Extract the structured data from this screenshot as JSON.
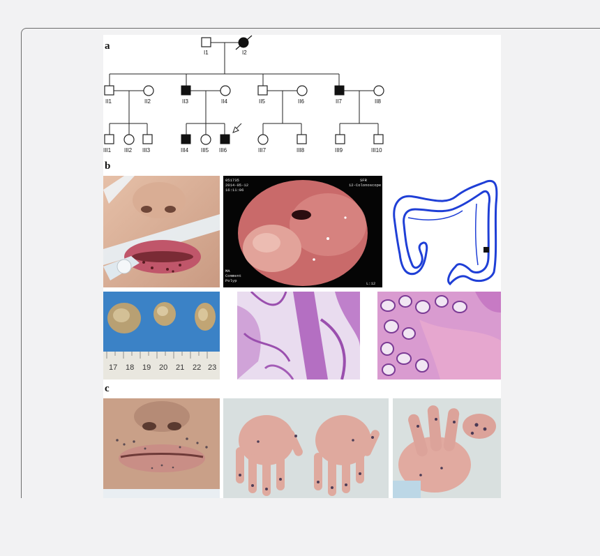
{
  "figure": {
    "panel_labels": [
      "a",
      "b",
      "c"
    ]
  },
  "pedigree": {
    "members": [
      {
        "id": "I1",
        "sex": "male",
        "affected": false,
        "deceased": false
      },
      {
        "id": "I2",
        "sex": "female",
        "affected": true,
        "deceased": true
      },
      {
        "id": "II1",
        "sex": "male",
        "affected": false
      },
      {
        "id": "II2",
        "sex": "female",
        "affected": false
      },
      {
        "id": "II3",
        "sex": "male",
        "affected": true
      },
      {
        "id": "II4",
        "sex": "female",
        "affected": false
      },
      {
        "id": "II5",
        "sex": "male",
        "affected": false
      },
      {
        "id": "II6",
        "sex": "female",
        "affected": false
      },
      {
        "id": "II7",
        "sex": "male",
        "affected": true
      },
      {
        "id": "II8",
        "sex": "female",
        "affected": false
      },
      {
        "id": "III1",
        "sex": "male",
        "affected": false
      },
      {
        "id": "III2",
        "sex": "female",
        "affected": false
      },
      {
        "id": "III3",
        "sex": "male",
        "affected": false
      },
      {
        "id": "III4",
        "sex": "male",
        "affected": true
      },
      {
        "id": "III5",
        "sex": "female",
        "affected": false
      },
      {
        "id": "III6",
        "sex": "male",
        "affected": true,
        "proband": true
      },
      {
        "id": "III7",
        "sex": "female",
        "affected": false
      },
      {
        "id": "III8",
        "sex": "male",
        "affected": false
      },
      {
        "id": "III9",
        "sex": "male",
        "affected": false
      },
      {
        "id": "III10",
        "sex": "male",
        "affected": false
      }
    ]
  },
  "endoscopy": {
    "overlay_left": [
      "051735",
      "2014-05-12",
      "16:11:06"
    ],
    "overlay_right": [
      "SFR",
      "12-Colonoscope"
    ],
    "overlay_bottom_left": [
      "MA",
      "Comment",
      "Polyp"
    ],
    "overlay_bottom_right": "L:12"
  },
  "ruler": {
    "numbers": [
      "17",
      "18",
      "19",
      "20",
      "21",
      "22",
      "23"
    ]
  },
  "colors": {
    "colon_outline": "#1f3fd6",
    "histology_stain": "#b46fc2",
    "endoscopy_mucosa": "#c96a6a"
  }
}
